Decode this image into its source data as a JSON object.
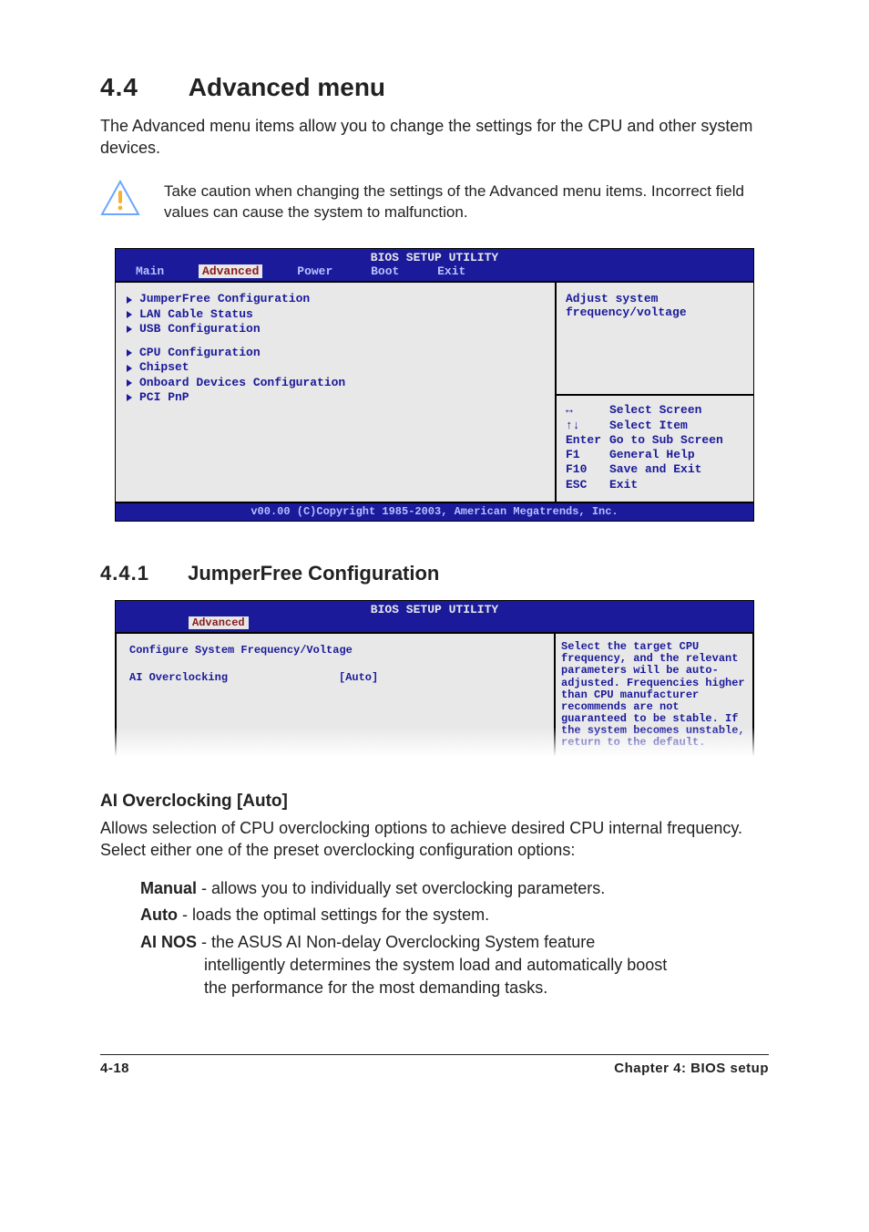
{
  "section": {
    "number": "4.4",
    "title": "Advanced menu"
  },
  "intro": "The Advanced menu items allow you to change the settings for the CPU and other system devices.",
  "caution": "Take caution when changing the settings of the Advanced menu items. Incorrect field values can cause the system to malfunction.",
  "bios1": {
    "title": "BIOS SETUP UTILITY",
    "menu": {
      "items": [
        "Main",
        "Advanced",
        "Power",
        "Boot",
        "Exit"
      ],
      "active": "Advanced"
    },
    "groups": [
      [
        "JumperFree Configuration",
        "LAN Cable Status",
        "USB Configuration"
      ],
      [
        "CPU Configuration",
        "Chipset",
        "Onboard Devices Configuration",
        "PCI PnP"
      ]
    ],
    "help": "Adjust system frequency/voltage",
    "keys": [
      {
        "k": "↔",
        "a": "Select Screen"
      },
      {
        "k": "↑↓",
        "a": "Select Item"
      },
      {
        "k": "Enter",
        "a": "Go to Sub Screen"
      },
      {
        "k": "F1",
        "a": "General Help"
      },
      {
        "k": "F10",
        "a": "Save and Exit"
      },
      {
        "k": "ESC",
        "a": "Exit"
      }
    ],
    "copyright": "v00.00 (C)Copyright 1985-2003, American Megatrends, Inc."
  },
  "subsection": {
    "number": "4.4.1",
    "title": "JumperFree Configuration"
  },
  "bios2": {
    "title": "BIOS SETUP UTILITY",
    "tab": "Advanced",
    "heading": "Configure System Frequency/Voltage",
    "setting_label": "AI Overclocking",
    "setting_value": "[Auto]",
    "help": "Select the target CPU frequency, and the relevant parameters will be auto-adjusted. Frequencies higher than CPU manufacturer recommends are not guaranteed to be stable. If the system becomes unstable, return to the default."
  },
  "option": {
    "heading": "AI Overclocking [Auto]",
    "para": "Allows selection of CPU overclocking options to achieve desired CPU internal frequency. Select either one of the preset overclocking configuration options:",
    "items": {
      "manual": {
        "name": "Manual",
        "desc": " - allows you to individually set overclocking parameters."
      },
      "auto": {
        "name": "Auto",
        "desc": " - loads the optimal settings for the system."
      },
      "ainos": {
        "name": "AI NOS",
        "line1": " - the ASUS AI Non-delay Overclocking System feature",
        "line2": "intelligently determines the system load and automatically boost",
        "line3": "the performance for the most demanding tasks."
      }
    }
  },
  "footer": {
    "left": "4-18",
    "right": "Chapter 4: BIOS setup"
  }
}
